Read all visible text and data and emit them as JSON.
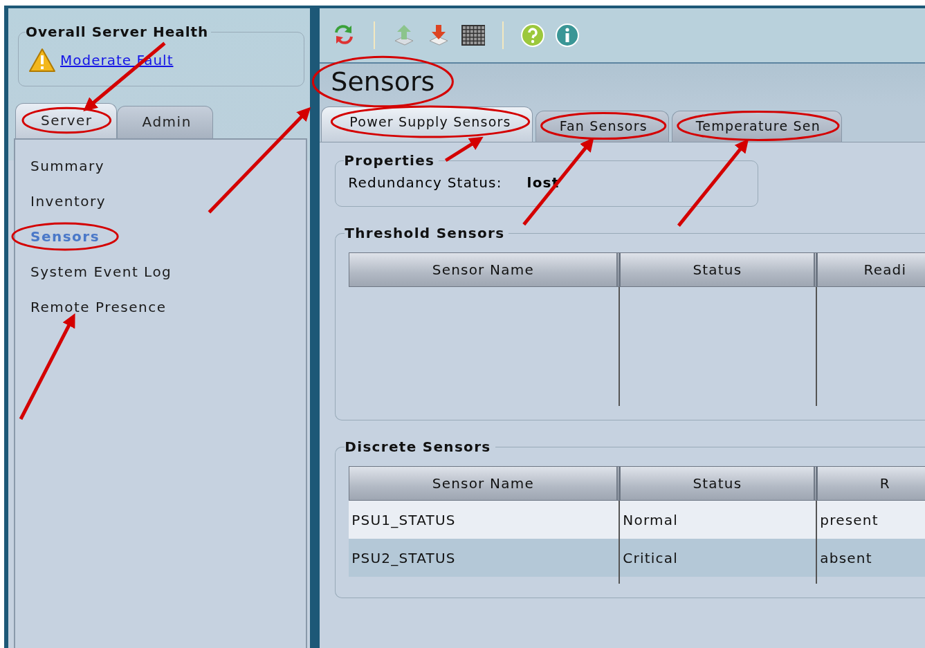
{
  "health": {
    "title": "Overall Server Health",
    "status_link": "Moderate Fault"
  },
  "nav_tabs": [
    {
      "label": "Server",
      "selected": true
    },
    {
      "label": "Admin",
      "selected": false
    }
  ],
  "nav_items": [
    {
      "label": "Summary",
      "selected": false
    },
    {
      "label": "Inventory",
      "selected": false
    },
    {
      "label": "Sensors",
      "selected": true
    },
    {
      "label": "System Event Log",
      "selected": false
    },
    {
      "label": "Remote Presence",
      "selected": false
    }
  ],
  "toolbar": [
    {
      "kind": "refresh"
    },
    {
      "kind": "separator"
    },
    {
      "kind": "upload"
    },
    {
      "kind": "download"
    },
    {
      "kind": "keyboard"
    },
    {
      "kind": "separator"
    },
    {
      "kind": "help"
    },
    {
      "kind": "info"
    }
  ],
  "page_title": "Sensors",
  "tabs": [
    {
      "label": "Power Supply Sensors",
      "selected": true
    },
    {
      "label": "Fan Sensors",
      "selected": false
    },
    {
      "label": "Temperature Sen",
      "selected": false
    }
  ],
  "properties": {
    "title": "Properties",
    "fields": [
      {
        "label": "Redundancy Status:",
        "value": "lost"
      }
    ]
  },
  "threshold_sensors": {
    "title": "Threshold Sensors",
    "columns": [
      "Sensor Name",
      "Status",
      "Readi"
    ]
  },
  "discrete_sensors": {
    "title": "Discrete Sensors",
    "columns": [
      "Sensor Name",
      "Status",
      "R"
    ],
    "rows": [
      {
        "cells": [
          "PSU1_STATUS",
          "Normal",
          "present"
        ],
        "selected": false
      },
      {
        "cells": [
          "PSU2_STATUS",
          "Critical",
          "absent"
        ],
        "selected": true
      }
    ]
  }
}
